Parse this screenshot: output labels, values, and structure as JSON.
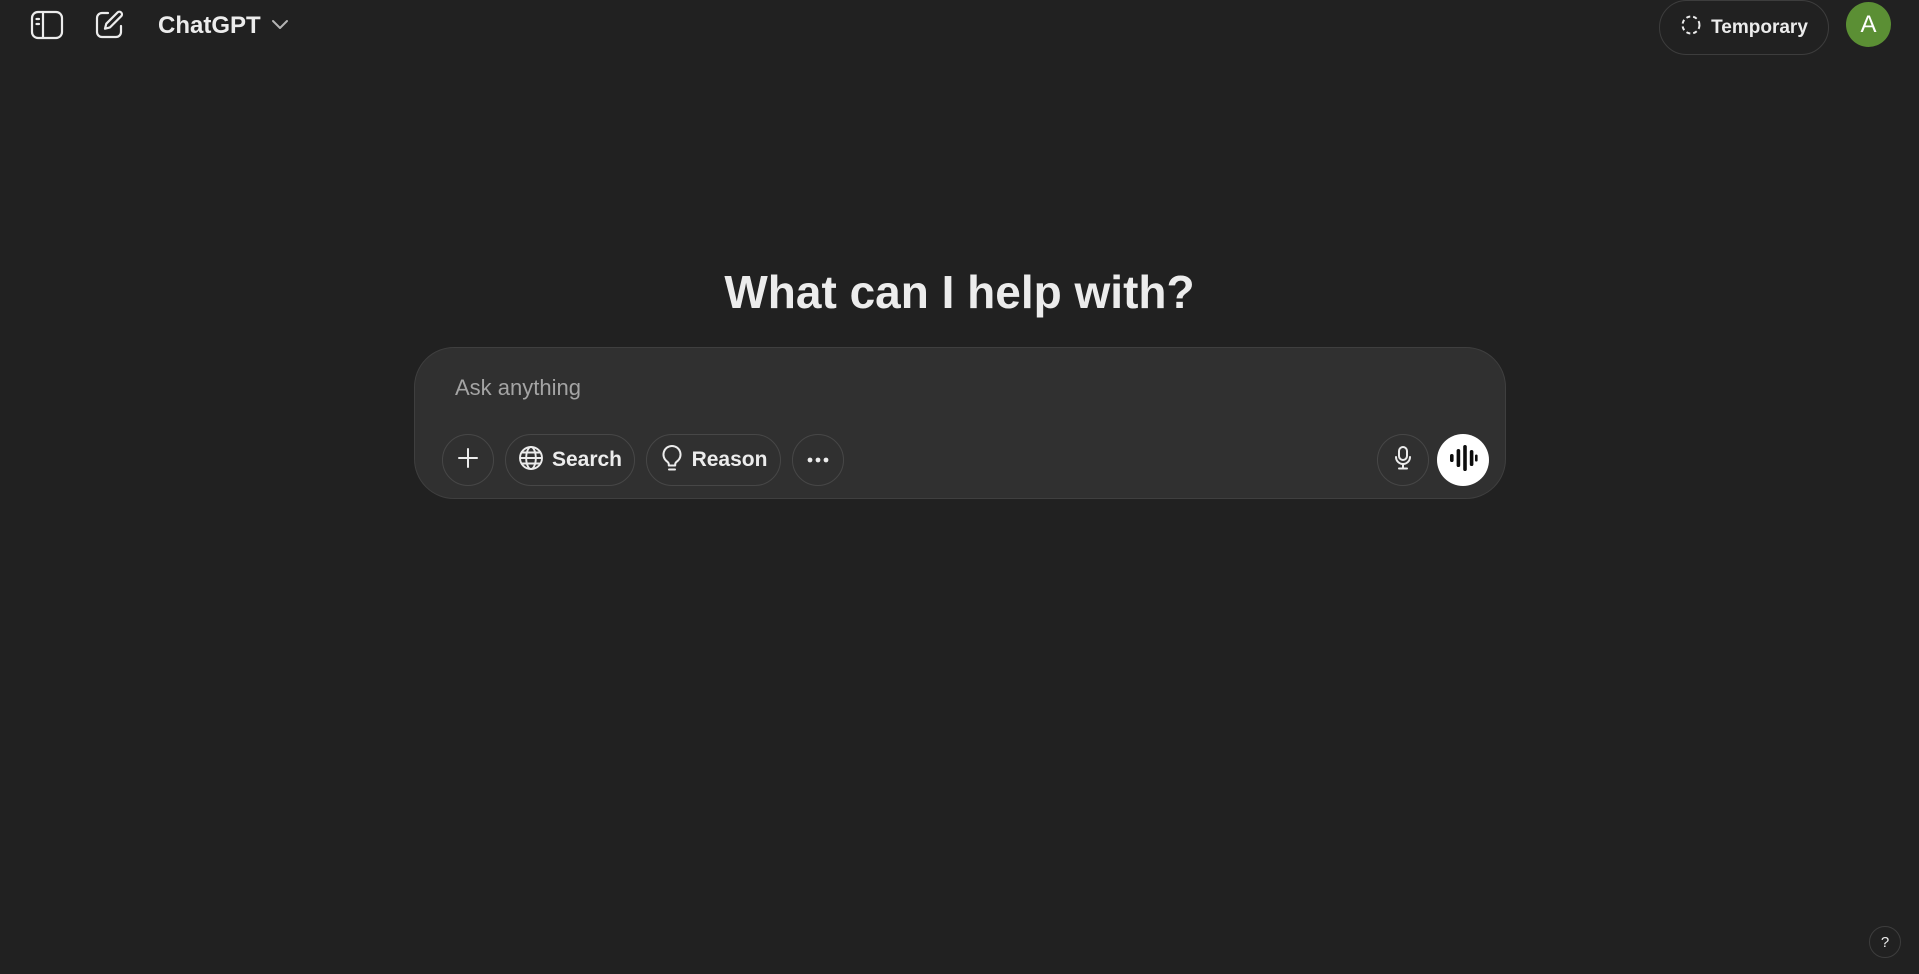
{
  "header": {
    "model_name": "ChatGPT",
    "temporary_label": "Temporary",
    "avatar_initial": "A",
    "avatar_color": "#5b8f34",
    "icons": {
      "sidebar": "sidebar-toggle-icon",
      "new_chat": "new-chat-pencil-icon",
      "model_dropdown": "chevron-down-icon",
      "temporary": "dashed-circle-icon"
    }
  },
  "main": {
    "heading": "What can I help with?"
  },
  "composer": {
    "placeholder": "Ask anything",
    "value": "",
    "buttons": {
      "search_label": "Search",
      "reason_label": "Reason"
    },
    "icons": {
      "attach": "plus-icon",
      "search": "globe-icon",
      "reason": "lightbulb-icon",
      "more": "ellipsis-icon",
      "dictate": "microphone-icon",
      "voice": "voice-waveform-icon"
    }
  },
  "footer": {
    "help_label": "?"
  },
  "theme": {
    "background": "#212121",
    "composer_background": "#303030",
    "text": "#ececec",
    "placeholder": "#a4a4a4"
  }
}
